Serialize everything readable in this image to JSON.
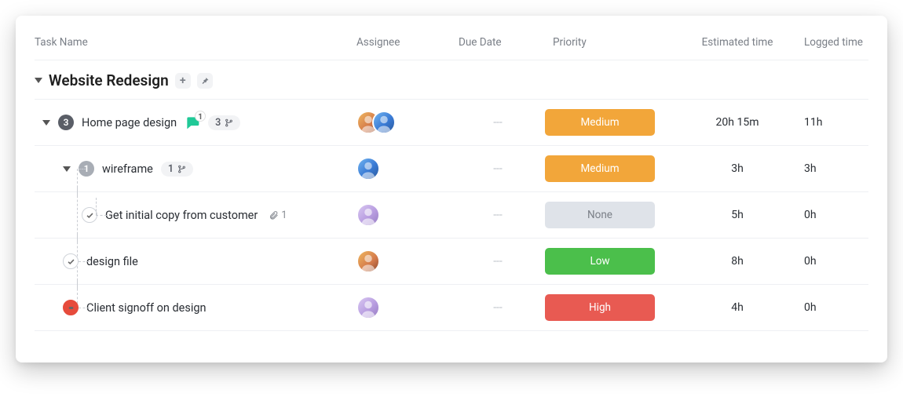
{
  "columns": {
    "task_name": "Task Name",
    "assignee": "Assignee",
    "due_date": "Due Date",
    "priority": "Priority",
    "estimated": "Estimated time",
    "logged": "Logged time"
  },
  "group": {
    "title": "Website Redesign"
  },
  "tasks": {
    "t0": {
      "name": "Home page design",
      "count": "3",
      "comment_count": "1",
      "subtask_count": "3",
      "due": "---",
      "priority": "Medium",
      "estimated": "20h 15m",
      "logged": "11h"
    },
    "t1": {
      "name": "wireframe",
      "count": "1",
      "subtask_count": "1",
      "due": "---",
      "priority": "Medium",
      "estimated": "3h",
      "logged": "3h"
    },
    "t2": {
      "name": "Get initial copy from customer",
      "attach_count": "1",
      "due": "---",
      "priority": "None",
      "estimated": "5h",
      "logged": "0h"
    },
    "t3": {
      "name": "design file",
      "due": "---",
      "priority": "Low",
      "estimated": "8h",
      "logged": "0h"
    },
    "t4": {
      "name": "Client signoff on design",
      "due": "---",
      "priority": "High",
      "estimated": "4h",
      "logged": "0h"
    }
  }
}
